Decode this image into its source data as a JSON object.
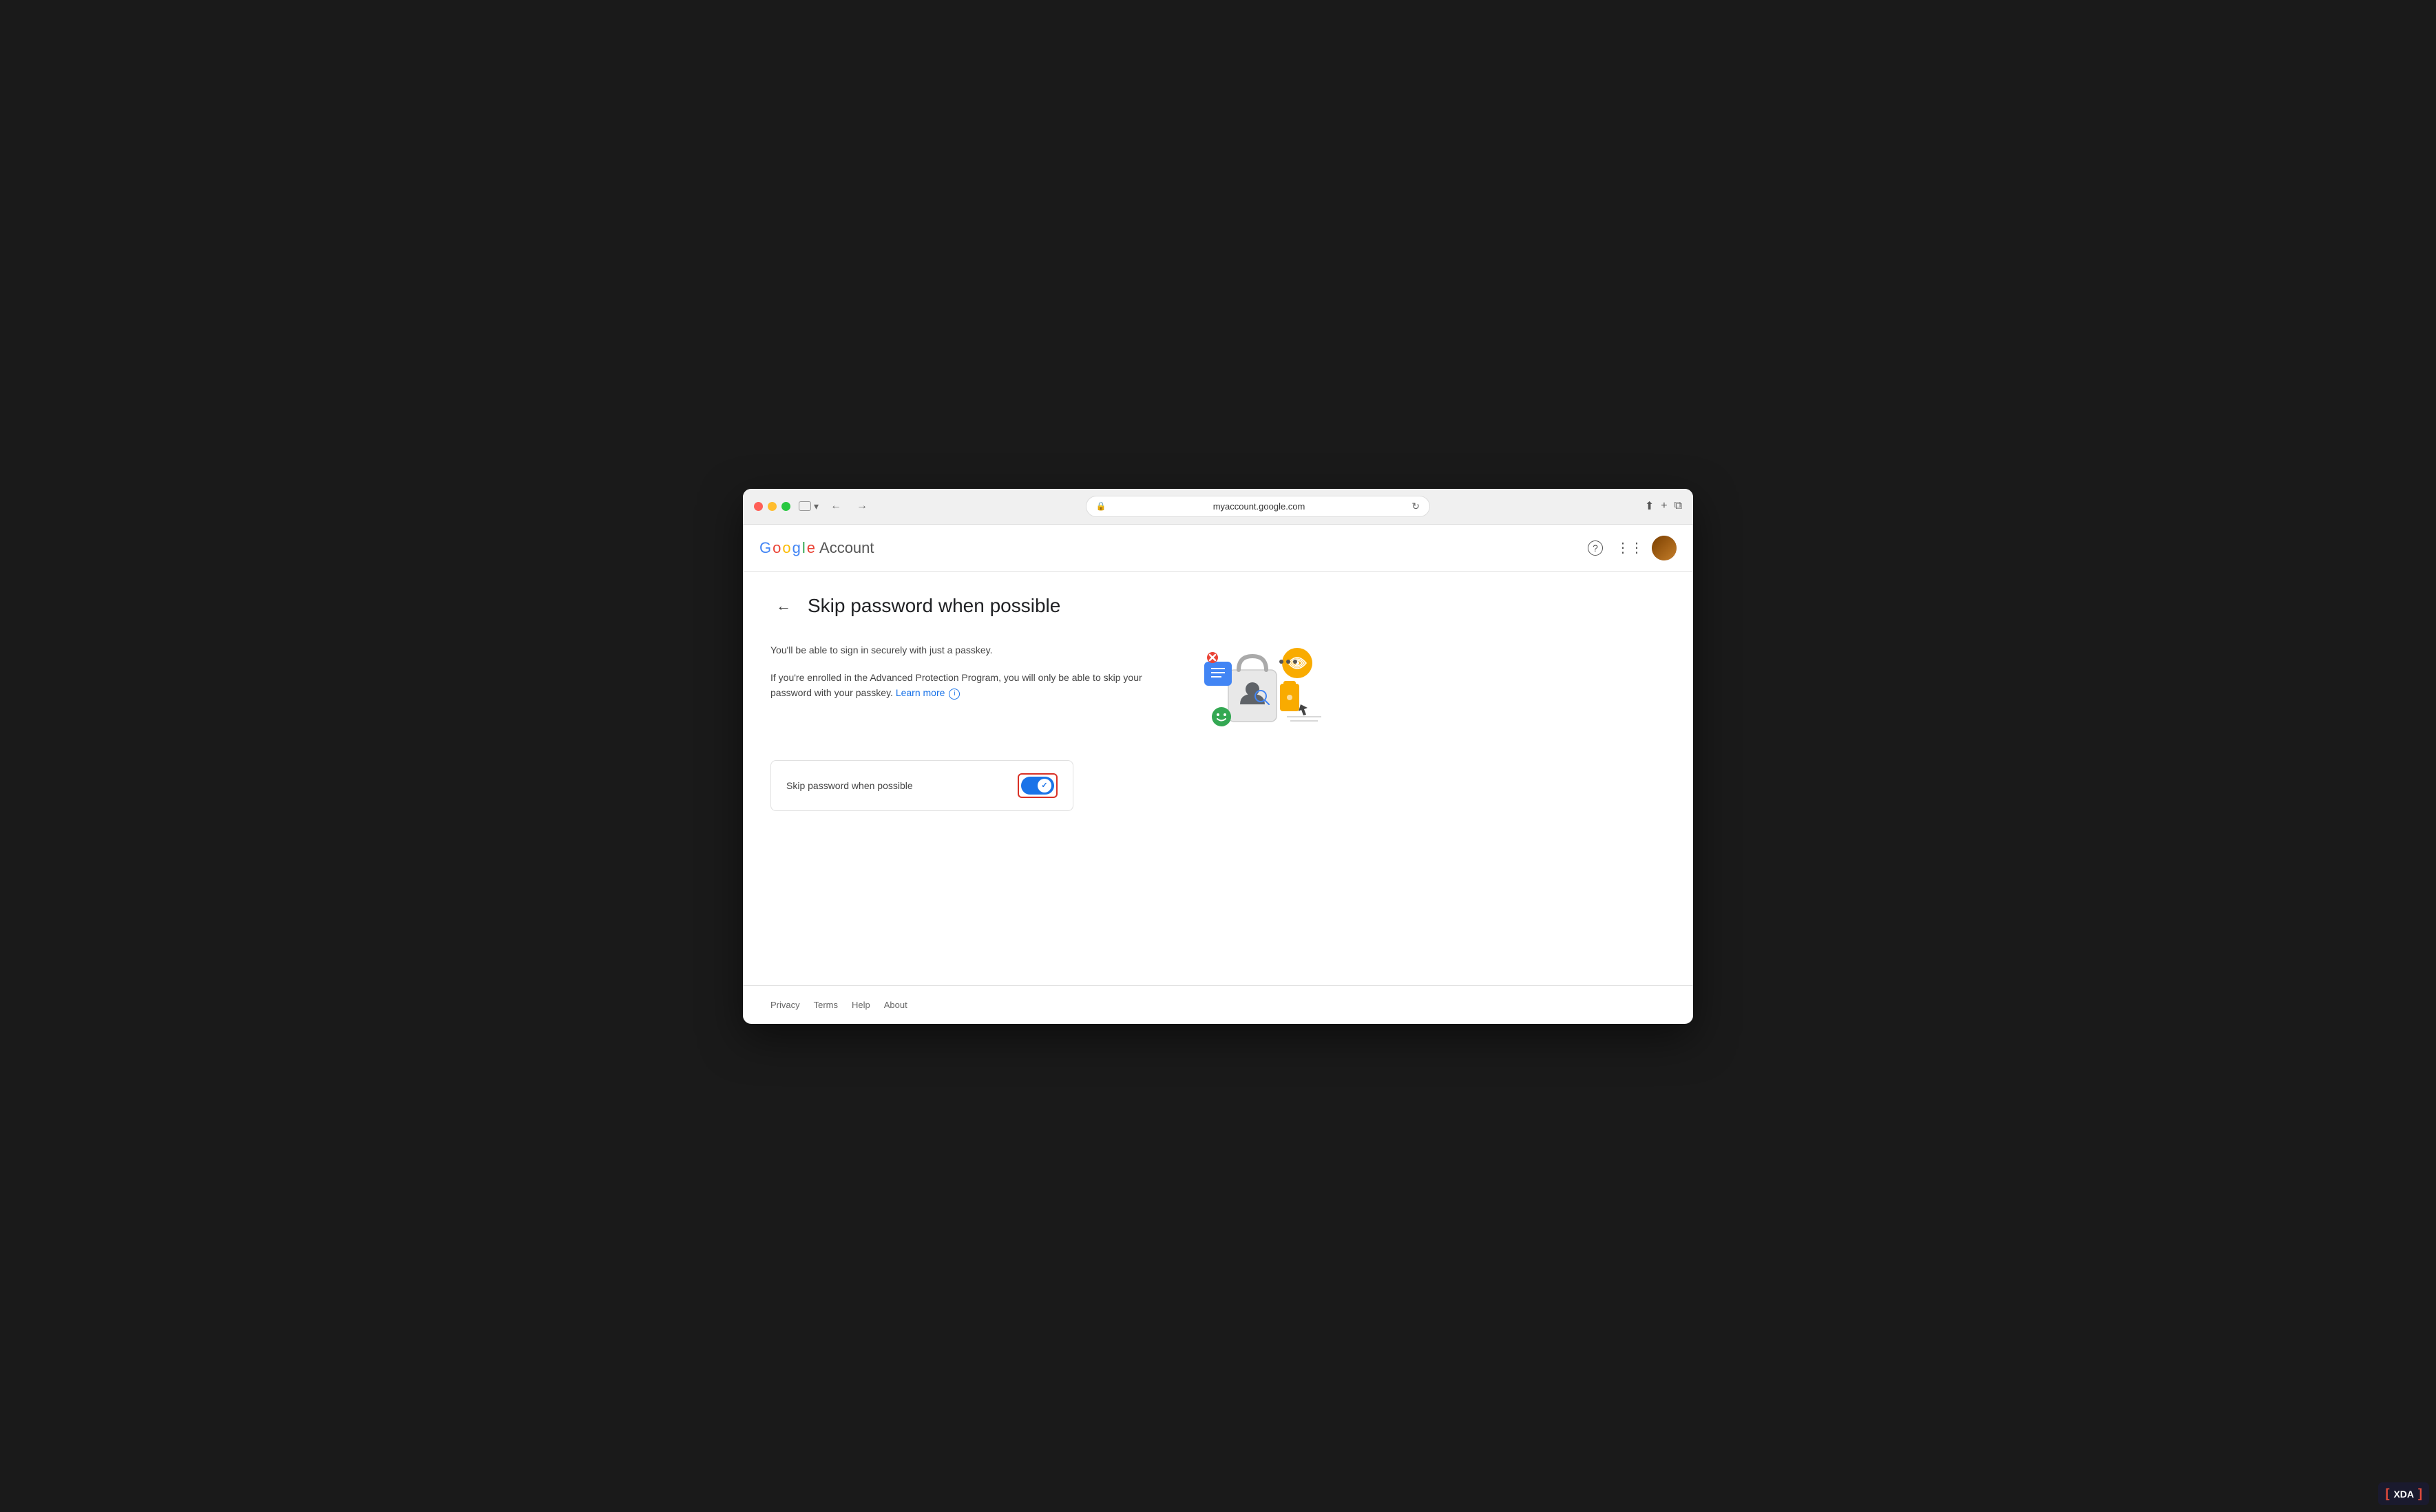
{
  "browser": {
    "url": "myaccount.google.com",
    "tab_icon": "tab-icon",
    "back_label": "←",
    "forward_label": "→",
    "refresh_label": "↻"
  },
  "header": {
    "logo": {
      "google_text": "Google",
      "account_text": "Account"
    },
    "actions": {
      "help_label": "?",
      "apps_label": "⋮⋮",
      "avatar_alt": "User avatar"
    }
  },
  "page": {
    "back_button": "←",
    "title": "Skip password when possible",
    "description_1": "You'll be able to sign in securely with just a passkey.",
    "description_2": "If you're enrolled in the Advanced Protection Program, you will only be able to skip your password with your passkey.",
    "learn_more": "Learn more",
    "setting_label": "Skip password when possible",
    "toggle_state": "enabled"
  },
  "footer": {
    "links": [
      "Privacy",
      "Terms",
      "Help",
      "About"
    ]
  },
  "colors": {
    "google_blue": "#4285F4",
    "google_red": "#EA4335",
    "google_yellow": "#FBBC05",
    "google_green": "#34A853",
    "toggle_blue": "#1a73e8",
    "highlight_red": "#d93025",
    "link_blue": "#1a73e8"
  }
}
